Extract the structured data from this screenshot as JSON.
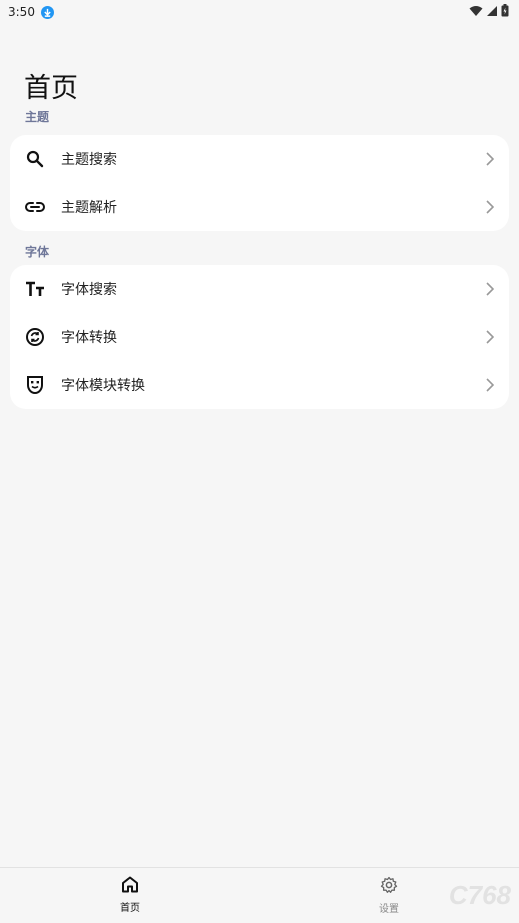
{
  "status_bar": {
    "time": "3:50"
  },
  "page": {
    "title": "首页"
  },
  "sections": [
    {
      "label": "主题",
      "items": [
        {
          "label": "主题搜索",
          "icon": "search-icon"
        },
        {
          "label": "主题解析",
          "icon": "link-icon"
        }
      ]
    },
    {
      "label": "字体",
      "items": [
        {
          "label": "字体搜索",
          "icon": "text-size-icon"
        },
        {
          "label": "字体转换",
          "icon": "convert-icon"
        },
        {
          "label": "字体模块转换",
          "icon": "module-icon"
        }
      ]
    }
  ],
  "bottom_nav": {
    "items": [
      {
        "label": "首页",
        "icon": "home-icon",
        "active": true
      },
      {
        "label": "设置",
        "icon": "gear-icon",
        "active": false
      }
    ]
  },
  "watermark": "C768",
  "colors": {
    "background": "#f6f6f6",
    "card": "#ffffff",
    "section_label": "#6f7799",
    "download_badge": "#2196f3"
  }
}
